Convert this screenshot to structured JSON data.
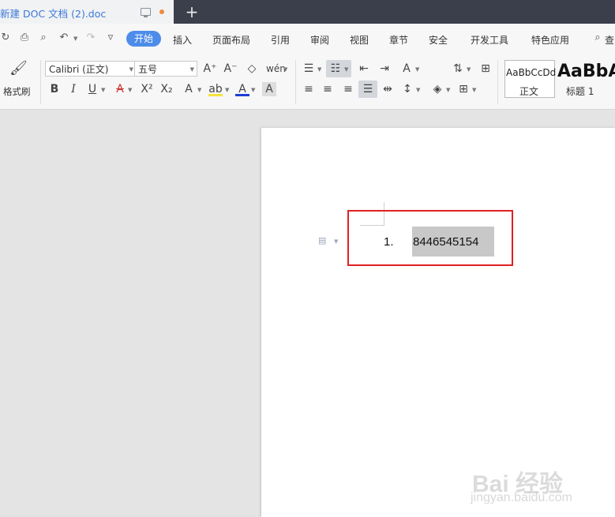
{
  "tab": {
    "title": "新建 DOC 文档 (2).doc",
    "new_tab": "+"
  },
  "menu": {
    "items": [
      "开始",
      "插入",
      "页面布局",
      "引用",
      "审阅",
      "视图",
      "章节",
      "安全",
      "开发工具",
      "特色应用",
      "查"
    ]
  },
  "ribbon": {
    "format_painter": "格式刷",
    "font_name": "Calibri (正文)",
    "font_size": "五号",
    "styles": [
      {
        "preview": "AaBbCcDd",
        "label": "正文"
      },
      {
        "preview": "AaBbA",
        "label": "标题 1"
      }
    ]
  },
  "document": {
    "list_number": "1.",
    "list_text": "8446545154"
  },
  "watermark": {
    "logo": "Bai 经验",
    "url": "jingyan.baidu.com"
  }
}
